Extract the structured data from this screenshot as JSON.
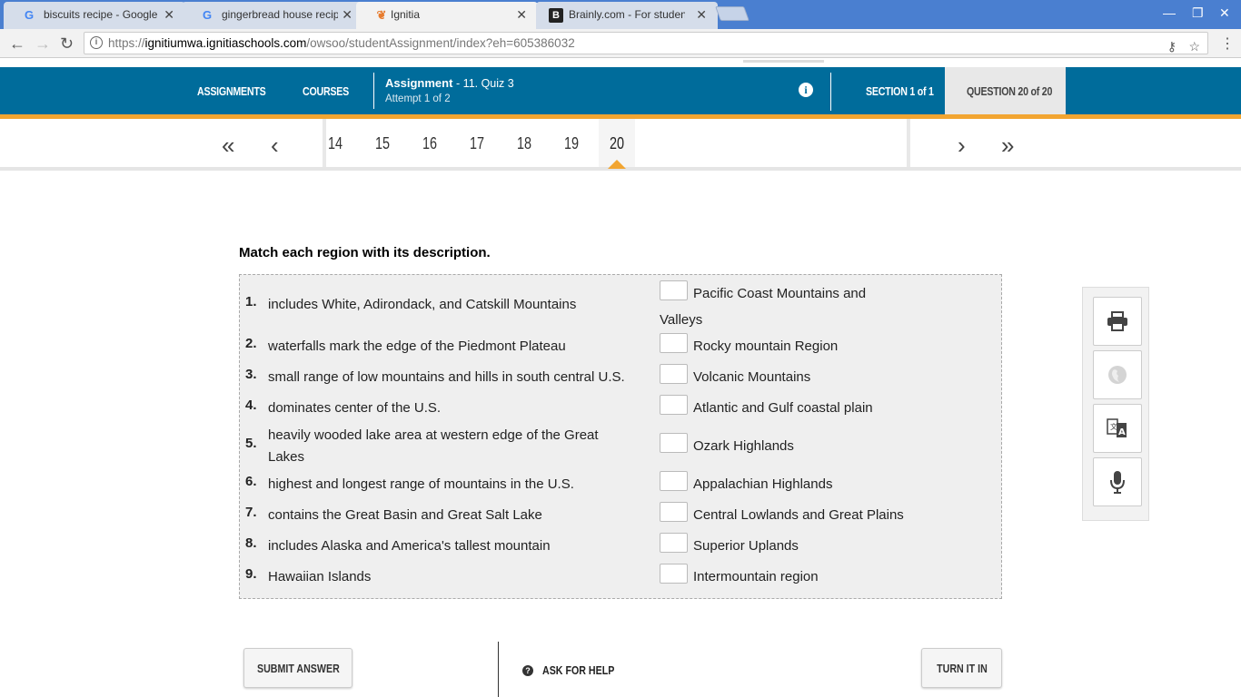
{
  "browser": {
    "tabs": [
      {
        "title": "biscuits recipe - Google S",
        "favicon": "G"
      },
      {
        "title": "gingerbread house recip",
        "favicon": "G"
      },
      {
        "title": "Ignitia",
        "favicon": "flame-icon"
      },
      {
        "title": "Brainly.com - For studen",
        "favicon": "B"
      }
    ],
    "url_scheme": "https://",
    "url_host": "ignitiumwa.ignitiaschools.com",
    "url_path": "/owsoo/studentAssignment/index?eh=605386032"
  },
  "header": {
    "assignments": "ASSIGNMENTS",
    "courses": "COURSES",
    "assignment_label": "Assignment",
    "assignment_sub": "- 11. Quiz 3",
    "attempt": "Attempt 1 of 2",
    "section": "SECTION 1 of 1",
    "question": "QUESTION 20 of 20"
  },
  "qnav": {
    "numbers": [
      "14",
      "15",
      "16",
      "17",
      "18",
      "19",
      "20"
    ],
    "current": "20"
  },
  "question": {
    "prompt": "Match each region with its description.",
    "items": [
      {
        "num": "1.",
        "text": "includes White, Adirondack, and Catskill Mountains"
      },
      {
        "num": "2.",
        "text": "waterfalls mark the edge of the Piedmont Plateau"
      },
      {
        "num": "3.",
        "text": "small range of low mountains and hills in south central U.S."
      },
      {
        "num": "4.",
        "text": "dominates center of the U.S."
      },
      {
        "num": "5.",
        "text": "heavily wooded lake area at western edge of the Great Lakes"
      },
      {
        "num": "6.",
        "text": "highest and longest range of mountains in the U.S."
      },
      {
        "num": "7.",
        "text": "contains the Great Basin and Great Salt Lake"
      },
      {
        "num": "8.",
        "text": "includes Alaska and America's tallest mountain"
      },
      {
        "num": "9.",
        "text": "Hawaiian Islands"
      }
    ],
    "options": [
      "Pacific Coast Mountains and",
      "Rocky mountain Region",
      "Volcanic Mountains",
      "Atlantic and Gulf coastal plain",
      "Ozark Highlands",
      "Appalachian Highlands",
      "Central Lowlands and Great Plains",
      "Superior Uplands",
      "Intermountain region"
    ],
    "option1_wrap": "Valleys"
  },
  "footer": {
    "submit": "SUBMIT ANSWER",
    "help": "ASK FOR HELP",
    "turn_in": "TURN IT IN"
  },
  "colors": {
    "header_bg": "#006c9b",
    "accent": "#f2a531"
  }
}
